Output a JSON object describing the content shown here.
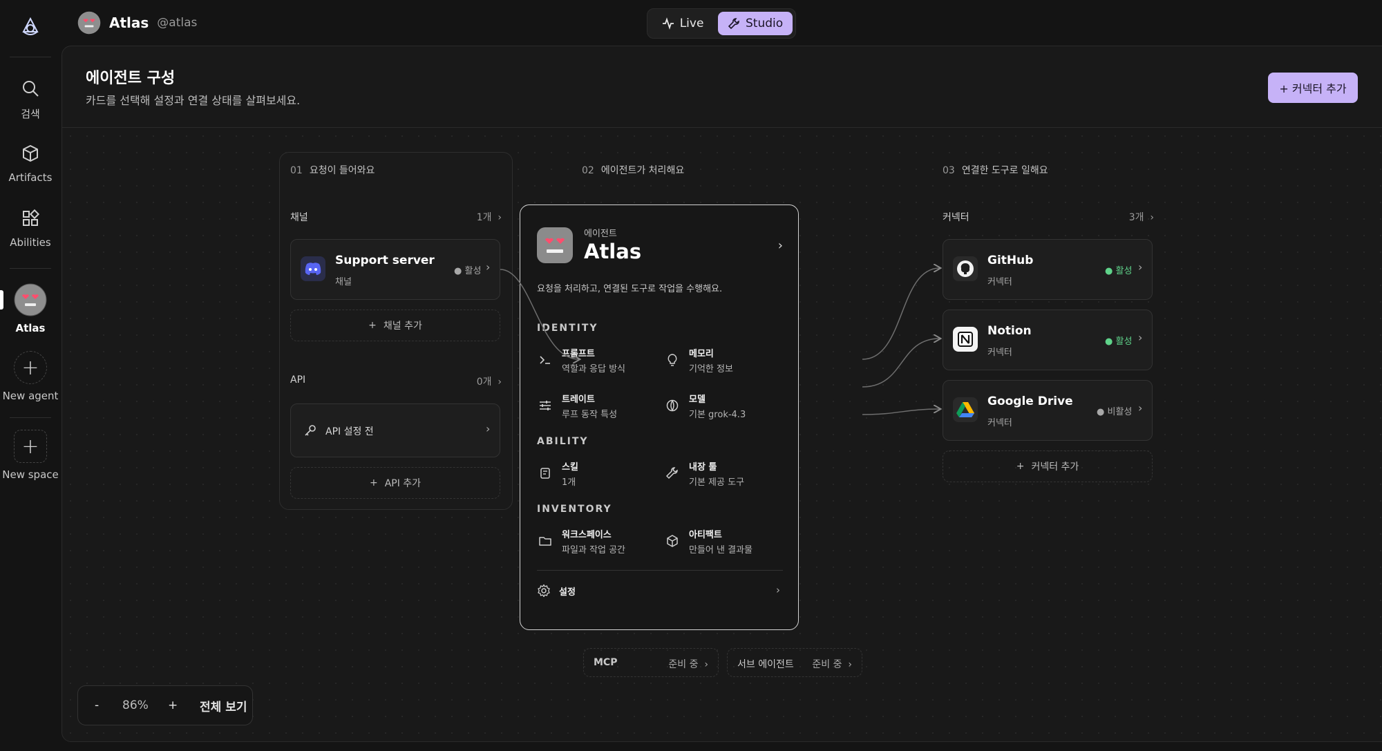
{
  "rail": {
    "search_label": "검색",
    "artifacts_label": "Artifacts",
    "abilities_label": "Abilities",
    "agent_label": "Atlas",
    "new_agent_label": "New agent",
    "new_space_label": "New space"
  },
  "topbar": {
    "agent_name": "Atlas",
    "agent_handle": "@atlas",
    "live_label": "Live",
    "studio_label": "Studio"
  },
  "panel": {
    "title": "에이전트 구성",
    "subtitle": "카드를 선택해 설정과 연결 상태를 살펴보세요.",
    "add_connector_label": "+ 커넥터 추가"
  },
  "col1": {
    "num": "01",
    "title": "요청이 들어와요",
    "channels_label": "채널",
    "channels_count": "1개",
    "channel": {
      "title": "Support server",
      "sub": "채널",
      "status": "활성"
    },
    "add_channel_label": "채널 추가",
    "api_label": "API",
    "api_count": "0개",
    "api_card_label": "API 설정 전",
    "add_api_label": "API 추가"
  },
  "col2": {
    "num": "02",
    "title": "에이전트가 처리해요",
    "kicker": "에이전트",
    "name": "Atlas",
    "desc": "요청을 처리하고, 연결된 도구로 작업을 수행해요.",
    "identity_label": "IDENTITY",
    "ability_label": "ABILITY",
    "inventory_label": "INVENTORY",
    "cells": {
      "prompt": {
        "title": "프롬프트",
        "sub": "역할과 응답 방식"
      },
      "memory": {
        "title": "메모리",
        "sub": "기억한 정보"
      },
      "traits": {
        "title": "트레이트",
        "sub": "루프 동작 특성"
      },
      "model": {
        "title": "모델",
        "sub": "기본 grok-4.3"
      },
      "skill": {
        "title": "스킬",
        "sub": "1개"
      },
      "builtin": {
        "title": "내장 툴",
        "sub": "기본 제공 도구"
      },
      "workspace": {
        "title": "워크스페이스",
        "sub": "파일과 작업 공간"
      },
      "artifact": {
        "title": "아티팩트",
        "sub": "만들어 낸 결과물"
      }
    },
    "settings_label": "설정",
    "mcp": {
      "label": "MCP",
      "status": "준비 중"
    },
    "sub_agent": {
      "label": "서브 에이전트",
      "status": "준비 중"
    }
  },
  "col3": {
    "num": "03",
    "title": "연결한 도구로 일해요",
    "connectors_label": "커넥터",
    "connectors_count": "3개",
    "github": {
      "title": "GitHub",
      "sub": "커넥터",
      "status": "활성"
    },
    "notion": {
      "title": "Notion",
      "sub": "커넥터",
      "status": "활성"
    },
    "gdrive": {
      "title": "Google Drive",
      "sub": "커넥터",
      "status": "비활성"
    },
    "add_connector_label": "커넥터 추가"
  },
  "zoom": {
    "minus": "-",
    "level": "86%",
    "plus": "+",
    "fit_label": "전체 보기"
  },
  "colors": {
    "accent": "#c6b2f7",
    "active_status": "#5fd38a",
    "discord": "#5865f2"
  }
}
